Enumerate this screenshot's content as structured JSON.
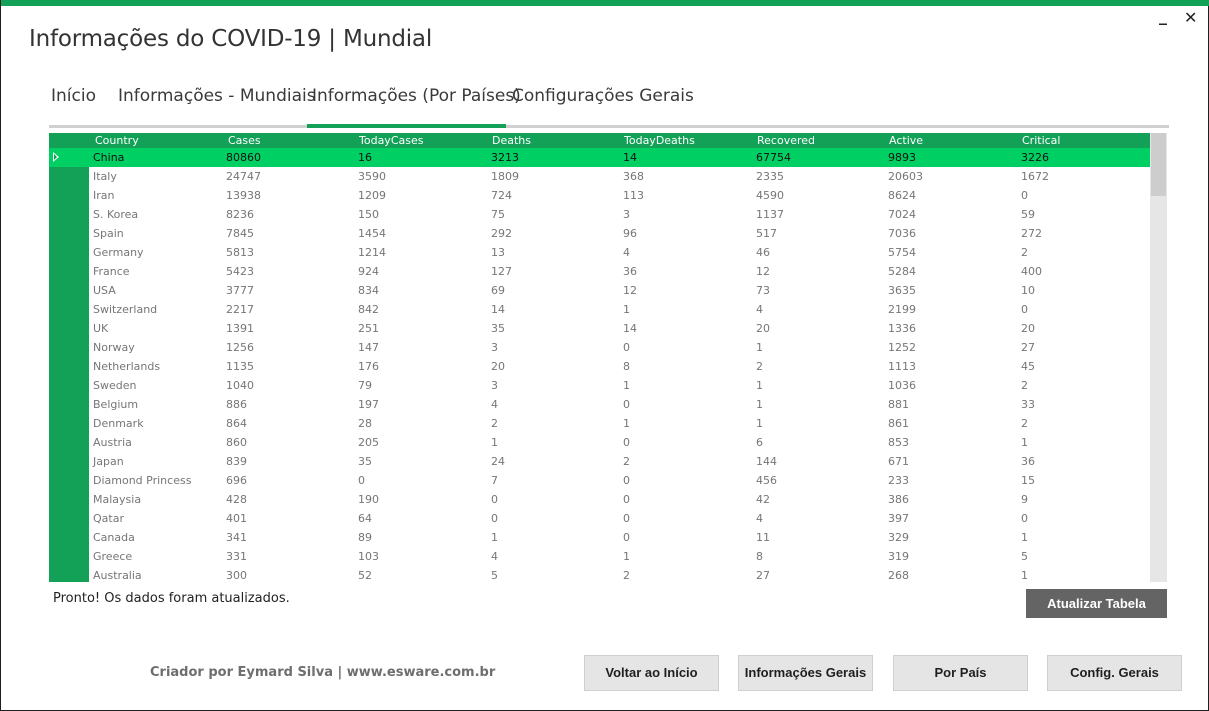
{
  "window": {
    "title": "Informações do COVID-19 | Mundial",
    "minimize_label": "_",
    "close_label": "✕"
  },
  "tabs": [
    {
      "label": "Início"
    },
    {
      "label": "Informações - Mundiais"
    },
    {
      "label": "Informações (Por Países)"
    },
    {
      "label": "Configurações Gerais"
    }
  ],
  "active_tab": "Informações (Por Países)",
  "table": {
    "columns": [
      "Country",
      "Cases",
      "TodayCases",
      "Deaths",
      "TodayDeaths",
      "Recovered",
      "Active",
      "Critical"
    ],
    "selected_row": 0,
    "rows": [
      [
        "China",
        "80860",
        "16",
        "3213",
        "14",
        "67754",
        "9893",
        "3226"
      ],
      [
        "Italy",
        "24747",
        "3590",
        "1809",
        "368",
        "2335",
        "20603",
        "1672"
      ],
      [
        "Iran",
        "13938",
        "1209",
        "724",
        "113",
        "4590",
        "8624",
        "0"
      ],
      [
        "S. Korea",
        "8236",
        "150",
        "75",
        "3",
        "1137",
        "7024",
        "59"
      ],
      [
        "Spain",
        "7845",
        "1454",
        "292",
        "96",
        "517",
        "7036",
        "272"
      ],
      [
        "Germany",
        "5813",
        "1214",
        "13",
        "4",
        "46",
        "5754",
        "2"
      ],
      [
        "France",
        "5423",
        "924",
        "127",
        "36",
        "12",
        "5284",
        "400"
      ],
      [
        "USA",
        "3777",
        "834",
        "69",
        "12",
        "73",
        "3635",
        "10"
      ],
      [
        "Switzerland",
        "2217",
        "842",
        "14",
        "1",
        "4",
        "2199",
        "0"
      ],
      [
        "UK",
        "1391",
        "251",
        "35",
        "14",
        "20",
        "1336",
        "20"
      ],
      [
        "Norway",
        "1256",
        "147",
        "3",
        "0",
        "1",
        "1252",
        "27"
      ],
      [
        "Netherlands",
        "1135",
        "176",
        "20",
        "8",
        "2",
        "1113",
        "45"
      ],
      [
        "Sweden",
        "1040",
        "79",
        "3",
        "1",
        "1",
        "1036",
        "2"
      ],
      [
        "Belgium",
        "886",
        "197",
        "4",
        "0",
        "1",
        "881",
        "33"
      ],
      [
        "Denmark",
        "864",
        "28",
        "2",
        "1",
        "1",
        "861",
        "2"
      ],
      [
        "Austria",
        "860",
        "205",
        "1",
        "0",
        "6",
        "853",
        "1"
      ],
      [
        "Japan",
        "839",
        "35",
        "24",
        "2",
        "144",
        "671",
        "36"
      ],
      [
        "Diamond Princess",
        "696",
        "0",
        "7",
        "0",
        "456",
        "233",
        "15"
      ],
      [
        "Malaysia",
        "428",
        "190",
        "0",
        "0",
        "42",
        "386",
        "9"
      ],
      [
        "Qatar",
        "401",
        "64",
        "0",
        "0",
        "4",
        "397",
        "0"
      ],
      [
        "Canada",
        "341",
        "89",
        "1",
        "0",
        "11",
        "329",
        "1"
      ],
      [
        "Greece",
        "331",
        "103",
        "4",
        "1",
        "8",
        "319",
        "5"
      ],
      [
        "Australia",
        "300",
        "52",
        "5",
        "2",
        "27",
        "268",
        "1"
      ]
    ]
  },
  "status": {
    "message": "Pronto! Os dados foram atualizados."
  },
  "buttons": {
    "refresh": "Atualizar Tabela",
    "home": "Voltar ao Início",
    "general_info": "Informações Gerais",
    "by_country": "Por País",
    "settings": "Config. Gerais"
  },
  "footer": {
    "credit": "Criador por Eymard Silva | www.esware.com.br"
  },
  "colors": {
    "accent": "#13a157",
    "selected_row": "#00d063",
    "button_dark": "#646464"
  }
}
